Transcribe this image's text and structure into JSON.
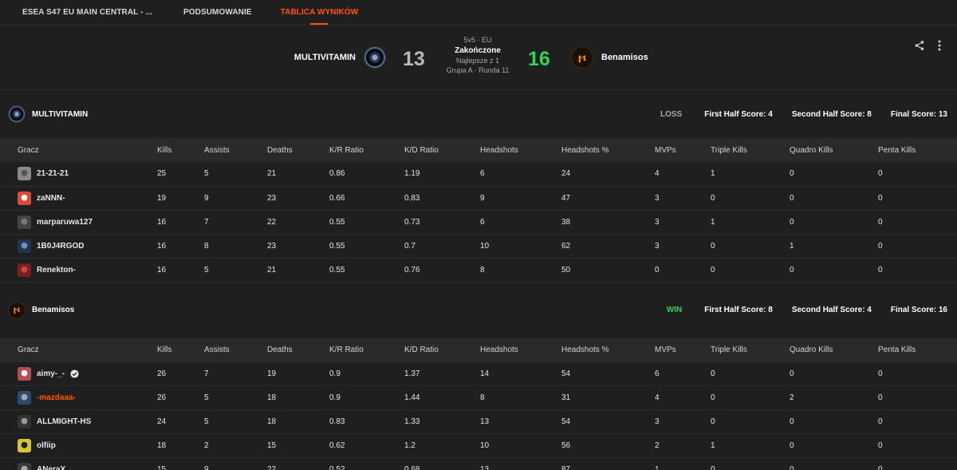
{
  "nav": {
    "tabs": [
      {
        "label": "ESEA S47 EU MAIN CENTRAL - ...",
        "active": false
      },
      {
        "label": "PODSUMOWANIE",
        "active": false
      },
      {
        "label": "TABLICA WYNIKÓW",
        "active": true
      }
    ],
    "accent": "#ff5500"
  },
  "match": {
    "left_team": "MULTIVITAMIN",
    "right_team": "Benamisos",
    "left_score": "13",
    "right_score": "16",
    "format": "5v5 · EU",
    "status": "Zakończone",
    "best_of": "Najlepsze z 1",
    "group": "Grupa A · Runda 11",
    "win_color": "#32d35a",
    "icons": [
      "share-icon",
      "more-vert-icon"
    ]
  },
  "columns": [
    "Gracz",
    "Kills",
    "Assists",
    "Deaths",
    "K/R Ratio",
    "K/D Ratio",
    "Headshots",
    "Headshots %",
    "MVPs",
    "Triple Kills",
    "Quadro Kills",
    "Penta Kills"
  ],
  "teams": [
    {
      "name": "MULTIVITAMIN",
      "result": "LOSS",
      "first_half": "First Half Score: 4",
      "second_half": "Second Half Score: 8",
      "final": "Final Score: 13",
      "players": [
        {
          "name": "21-21-21",
          "stats": [
            "25",
            "5",
            "21",
            "0.86",
            "1.19",
            "6",
            "24",
            "4",
            "1",
            "0",
            "0"
          ]
        },
        {
          "name": "zaNNN-",
          "stats": [
            "19",
            "9",
            "23",
            "0.66",
            "0.83",
            "9",
            "47",
            "3",
            "0",
            "0",
            "0"
          ]
        },
        {
          "name": "marparuwa127",
          "stats": [
            "16",
            "7",
            "22",
            "0.55",
            "0.73",
            "6",
            "38",
            "3",
            "1",
            "0",
            "0"
          ]
        },
        {
          "name": "1B0J4RGOD",
          "stats": [
            "16",
            "8",
            "23",
            "0.55",
            "0.7",
            "10",
            "62",
            "3",
            "0",
            "1",
            "0"
          ]
        },
        {
          "name": "Renekton-",
          "stats": [
            "16",
            "5",
            "21",
            "0.55",
            "0.76",
            "8",
            "50",
            "0",
            "0",
            "0",
            "0"
          ]
        }
      ]
    },
    {
      "name": "Benamisos",
      "result": "WIN",
      "first_half": "First Half Score: 8",
      "second_half": "Second Half Score: 4",
      "final": "Final Score: 16",
      "players": [
        {
          "name": "aimy-_-",
          "verified": true,
          "stats": [
            "26",
            "7",
            "19",
            "0.9",
            "1.37",
            "14",
            "54",
            "6",
            "0",
            "0",
            "0"
          ]
        },
        {
          "name": "-mazdaaa-",
          "highlight": true,
          "stats": [
            "26",
            "5",
            "18",
            "0.9",
            "1.44",
            "8",
            "31",
            "4",
            "0",
            "2",
            "0"
          ]
        },
        {
          "name": "ALLMIGHT-HS",
          "stats": [
            "24",
            "5",
            "18",
            "0.83",
            "1.33",
            "13",
            "54",
            "3",
            "0",
            "0",
            "0"
          ]
        },
        {
          "name": "olfiip",
          "stats": [
            "18",
            "2",
            "15",
            "0.62",
            "1.2",
            "10",
            "56",
            "2",
            "1",
            "0",
            "0"
          ]
        },
        {
          "name": "ANeraX",
          "stats": [
            "15",
            "9",
            "22",
            "0.52",
            "0.68",
            "13",
            "87",
            "1",
            "0",
            "0",
            "0"
          ]
        }
      ]
    }
  ]
}
